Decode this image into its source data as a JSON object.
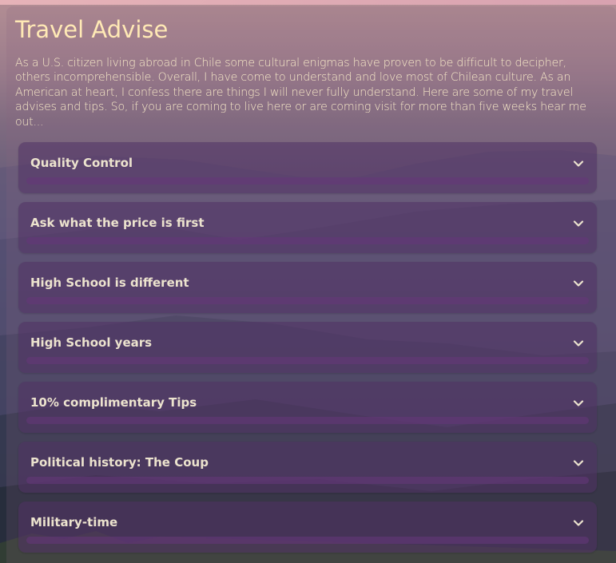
{
  "page": {
    "title": "Travel Advise",
    "intro": "As a U.S. citizen living abroad in Chile some cultural enigmas have proven to be difficult to decipher, others incomprehensible. Overall, I have come to understand and love most of Chilean culture. As an American at heart, I confess there are things I will never fully understand. Here are some of my travel advises and tips. So, if you are coming to live here or are coming visit for more than five weeks hear me out..."
  },
  "accordion": {
    "items": [
      {
        "label": "Quality Control",
        "icon": "chevron-down-icon"
      },
      {
        "label": "Ask what the price is first",
        "icon": "chevron-down-icon"
      },
      {
        "label": "High School is different",
        "icon": "chevron-down-icon"
      },
      {
        "label": "High School years",
        "icon": "chevron-down-icon"
      },
      {
        "label": "10% complimentary Tips",
        "icon": "chevron-down-icon"
      },
      {
        "label": "Political history: The Coup",
        "icon": "chevron-down-icon"
      },
      {
        "label": "Military-time",
        "icon": "chevron-down-icon"
      }
    ]
  },
  "colors": {
    "title": "#ffe9b5",
    "intro_text": "#f7e9c8",
    "item_label": "#ece3ce",
    "item_background": "#503264",
    "top_bar": "#e6b3b8"
  }
}
